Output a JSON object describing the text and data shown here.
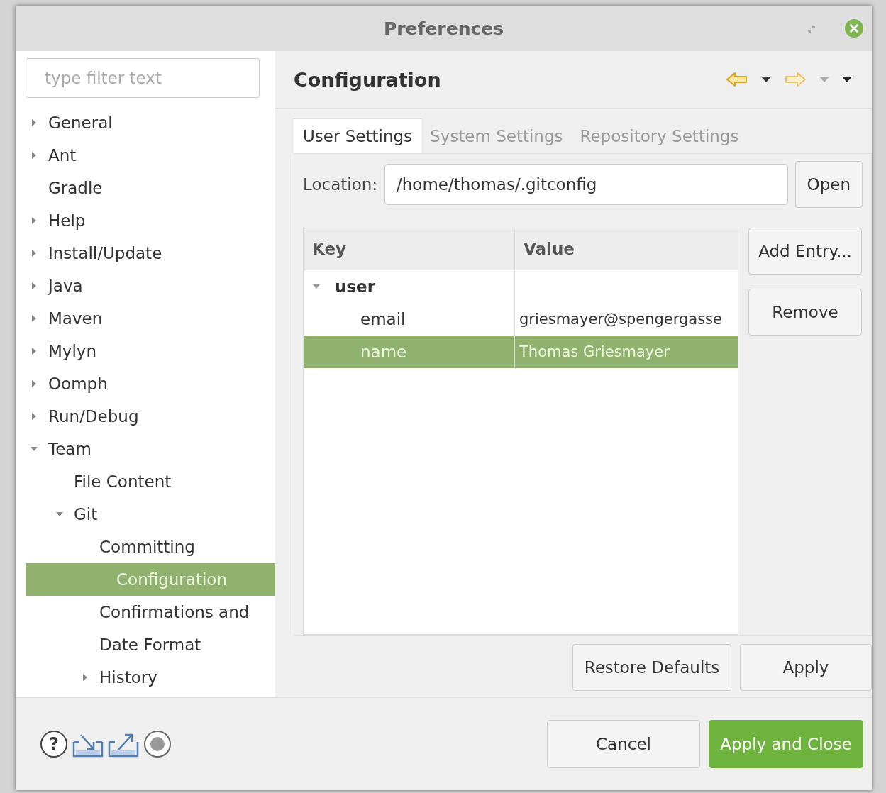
{
  "window": {
    "title": "Preferences"
  },
  "filter": {
    "placeholder": "type filter text"
  },
  "tree": [
    {
      "label": "General",
      "expanded": false,
      "selected": false
    },
    {
      "label": "Ant",
      "expanded": false,
      "selected": false
    },
    {
      "label": "Gradle",
      "selected": false
    },
    {
      "label": "Help",
      "expanded": false,
      "selected": false
    },
    {
      "label": "Install/Update",
      "expanded": false,
      "selected": false
    },
    {
      "label": "Java",
      "expanded": false,
      "selected": false
    },
    {
      "label": "Maven",
      "expanded": false,
      "selected": false
    },
    {
      "label": "Mylyn",
      "expanded": false,
      "selected": false
    },
    {
      "label": "Oomph",
      "expanded": false,
      "selected": false
    },
    {
      "label": "Run/Debug",
      "expanded": false,
      "selected": false
    },
    {
      "label": "Team",
      "expanded": true,
      "selected": false,
      "children": [
        {
          "label": "File Content",
          "selected": false
        },
        {
          "label": "Git",
          "expanded": true,
          "selected": false,
          "children": [
            {
              "label": "Committing",
              "selected": false
            },
            {
              "label": "Configuration",
              "selected": true
            },
            {
              "label": "Confirmations and",
              "selected": false
            },
            {
              "label": "Date Format",
              "selected": false
            },
            {
              "label": "History",
              "expanded": false,
              "selected": false
            }
          ]
        }
      ]
    }
  ],
  "page": {
    "title": "Configuration"
  },
  "tabs": [
    {
      "label": "User Settings",
      "selected": true
    },
    {
      "label": "System Settings",
      "selected": false
    },
    {
      "label": "Repository Settings",
      "selected": false
    }
  ],
  "location": {
    "label": "Location:",
    "value": "/home/thomas/.gitconfig",
    "button": "Open"
  },
  "table": {
    "columns": [
      "Key",
      "Value"
    ],
    "rows": [
      {
        "key": "user",
        "expanded": true,
        "selected": false,
        "children": [
          {
            "key": "email",
            "value": "griesmayer@spengergasse",
            "selected": false
          },
          {
            "key": "name",
            "value": "Thomas Griesmayer",
            "selected": true
          }
        ]
      }
    ]
  },
  "side_buttons": [
    "Add Entry...",
    "Remove"
  ],
  "page_buttons": [
    "Restore Defaults",
    "Apply"
  ],
  "help": {
    "glyph": "?"
  },
  "dialog_buttons": [
    {
      "label": "Cancel",
      "kind": "normal"
    },
    {
      "label": "Apply and Close",
      "kind": "primary"
    }
  ]
}
